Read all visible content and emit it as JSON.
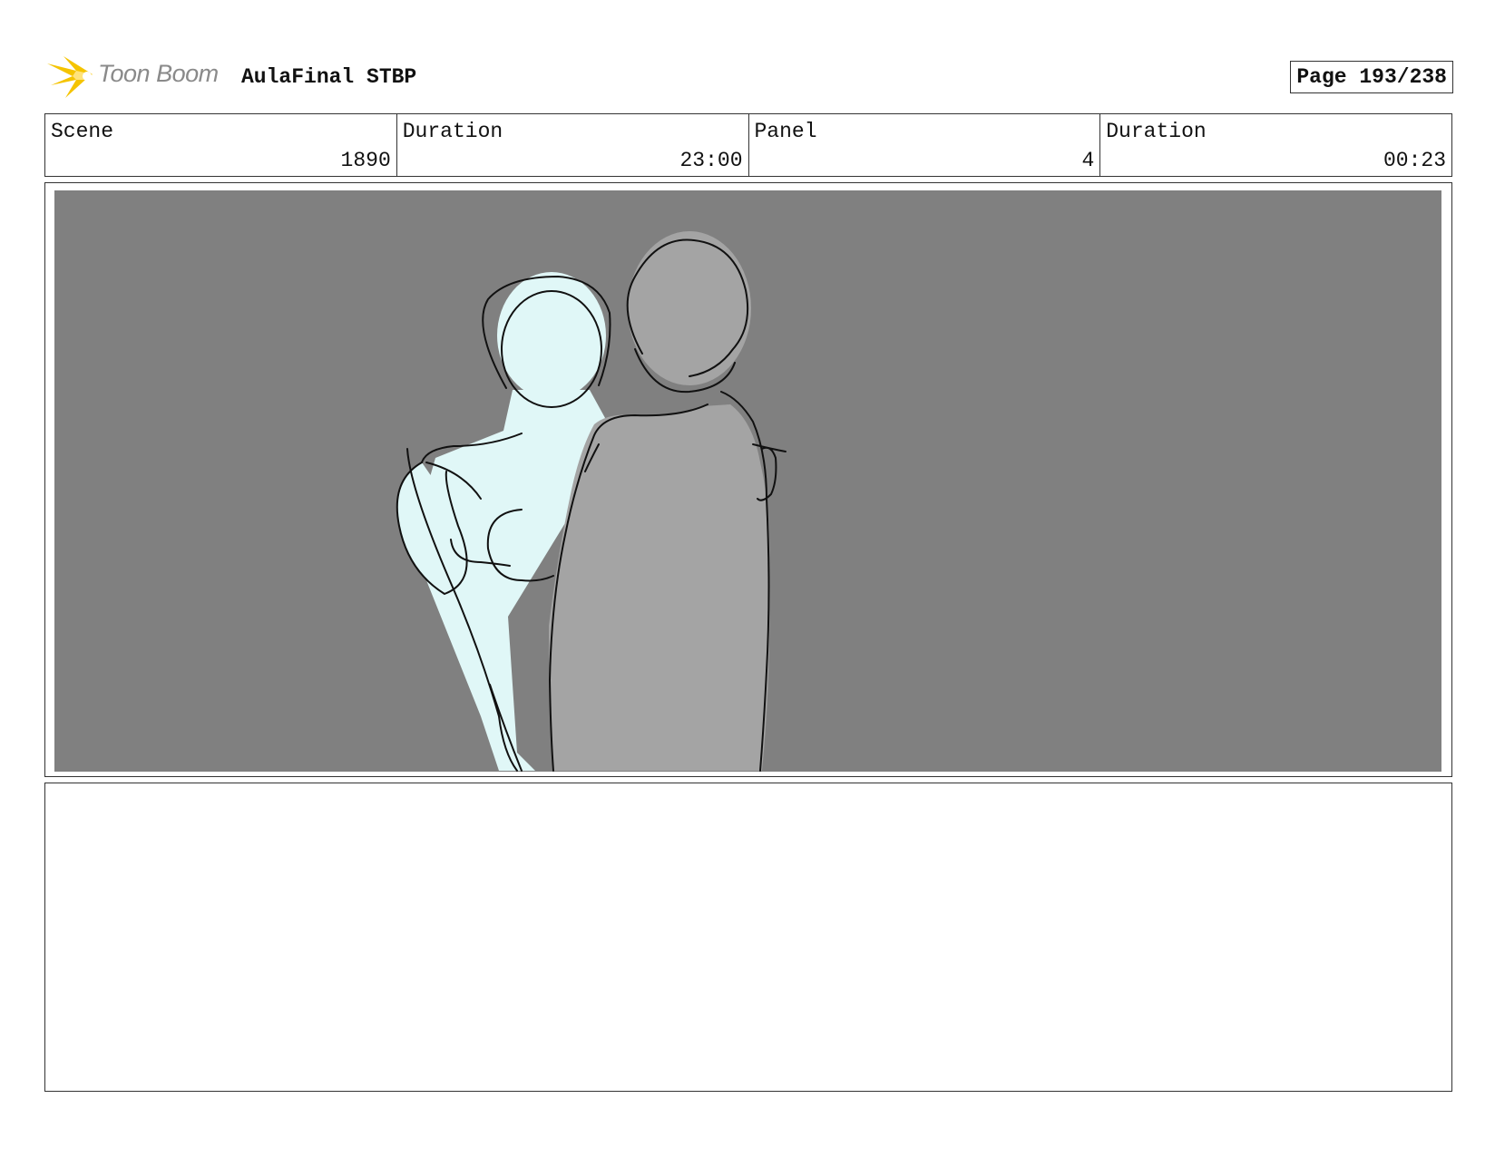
{
  "header": {
    "logo_text": "Toon Boom",
    "project_title": "AulaFinal STBP",
    "page_label": "Page 193/238"
  },
  "info": {
    "scene_label": "Scene",
    "scene_value": "1890",
    "scene_duration_label": "Duration",
    "scene_duration_value": "23:00",
    "panel_label": "Panel",
    "panel_value": "4",
    "panel_duration_label": "Duration",
    "panel_duration_value": "00:23"
  },
  "colors": {
    "panel_background": "#808080",
    "figure_light": "#e0f7f7",
    "figure_gray": "#a4a4a4",
    "logo_accent": "#f5c400"
  },
  "icons": {
    "logo": "toon-boom-starburst-icon"
  },
  "notes": {
    "text": ""
  }
}
